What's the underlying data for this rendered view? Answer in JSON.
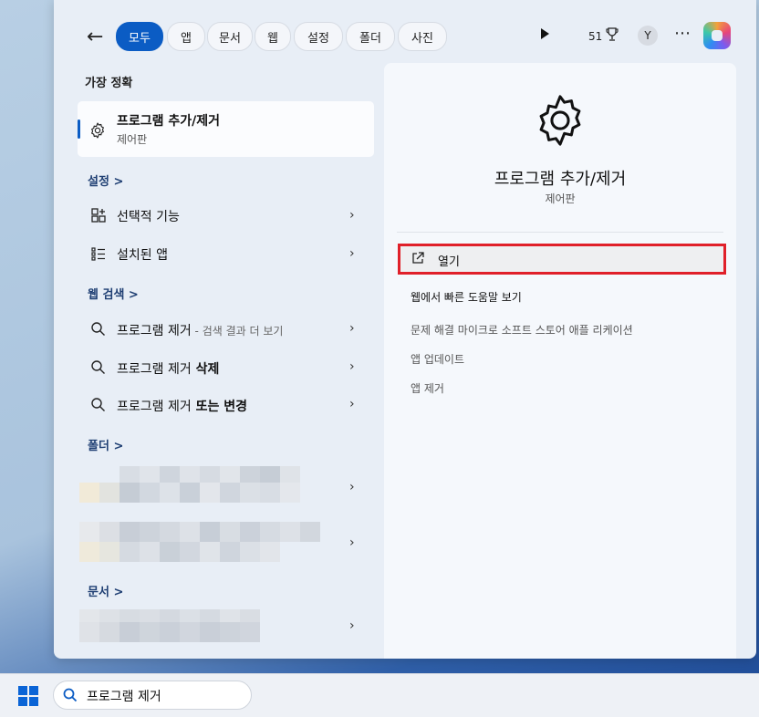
{
  "search": {
    "query": "프로그램 제거"
  },
  "header": {
    "filters": [
      "모두",
      "앱",
      "문서",
      "웹",
      "설정",
      "폴더",
      "사진"
    ],
    "active_filter": "모두",
    "points": "51"
  },
  "user": {
    "initial": "Y"
  },
  "best_match": {
    "section": "가장 정확",
    "title": "프로그램 추가/제거",
    "subtitle": "제어판"
  },
  "settings": {
    "section": "설정 >",
    "items": [
      "선택적 기능",
      "설치된 앱"
    ]
  },
  "web": {
    "section": "웹 검색 >",
    "items": [
      {
        "main": "프로그램 제거",
        "sub": " - 검색 결과 더 보기"
      },
      {
        "main": "프로그램 제거",
        "bold": " 삭제"
      },
      {
        "main": "프로그램 제거",
        "bold": " 또는 변경"
      }
    ]
  },
  "folders": {
    "section": "폴더 >"
  },
  "documents": {
    "section": "문서 >"
  },
  "detail": {
    "title": "프로그램 추가/제거",
    "subtitle": "제어판",
    "open_label": "열기",
    "help_label": "웹에서 빠른 도움말 보기",
    "links": [
      "문제 해결 마이크로 소프트 스토어 애플 리케이션",
      "앱 업데이트",
      "앱 제거"
    ]
  },
  "colors": {
    "accent": "#0b5cc4",
    "highlight_box": "#e0202a"
  }
}
